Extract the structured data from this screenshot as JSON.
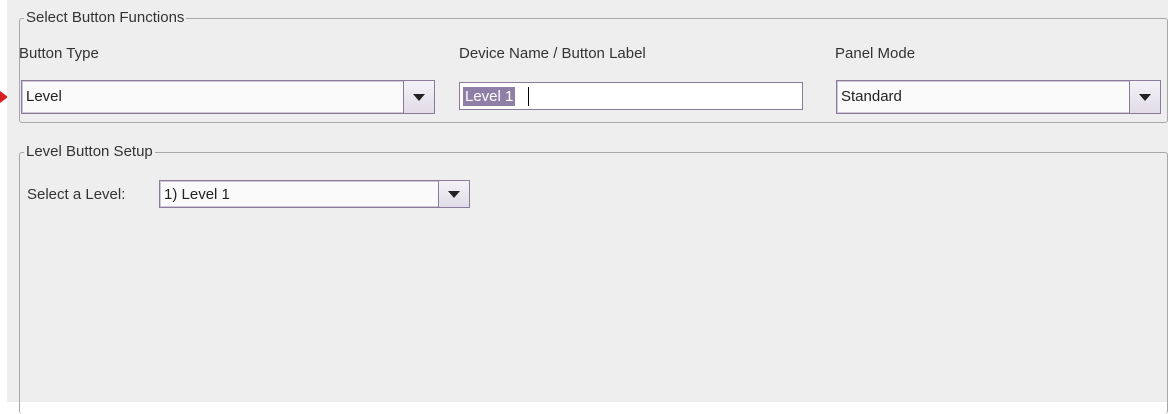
{
  "select_functions": {
    "legend": "Select Button Functions",
    "button_type": {
      "label": "Button Type",
      "value": "Level"
    },
    "device_name": {
      "label": "Device Name / Button Label",
      "value": "Level 1"
    },
    "panel_mode": {
      "label": "Panel Mode",
      "value": "Standard"
    }
  },
  "level_setup": {
    "legend": "Level Button Setup",
    "select_label": "Select a Level:",
    "select_value": "1) Level 1"
  },
  "icons": {
    "dropdown": "chevron-down-icon",
    "marker": "pointer-arrow-icon"
  },
  "colors": {
    "selection": "#8d7fa6",
    "field_border": "#8a7a9c",
    "marker": "#d81e1e"
  }
}
